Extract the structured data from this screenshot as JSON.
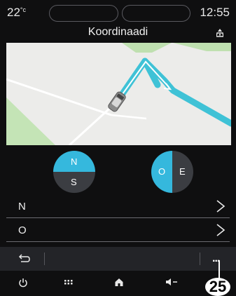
{
  "status": {
    "temperature": "22",
    "temp_unit": "°c",
    "time": "12:55"
  },
  "header": {
    "title": "Koordinaadi",
    "nav_icon": "navigation-pin-icon"
  },
  "compass": {
    "north": "N",
    "south": "S",
    "west": "O",
    "east": "E"
  },
  "rows": [
    {
      "label": "N"
    },
    {
      "label": "O"
    }
  ],
  "actionbar": {
    "back_icon": "back-arrow-icon",
    "more_label": "..."
  },
  "dock": {
    "icons": [
      "power-icon",
      "apps-grid-icon",
      "home-icon",
      "volume-down-icon"
    ]
  },
  "callout": "25",
  "colors": {
    "accent": "#35b8dd",
    "route": "#3fc2d6",
    "background": "#0f0f10"
  }
}
